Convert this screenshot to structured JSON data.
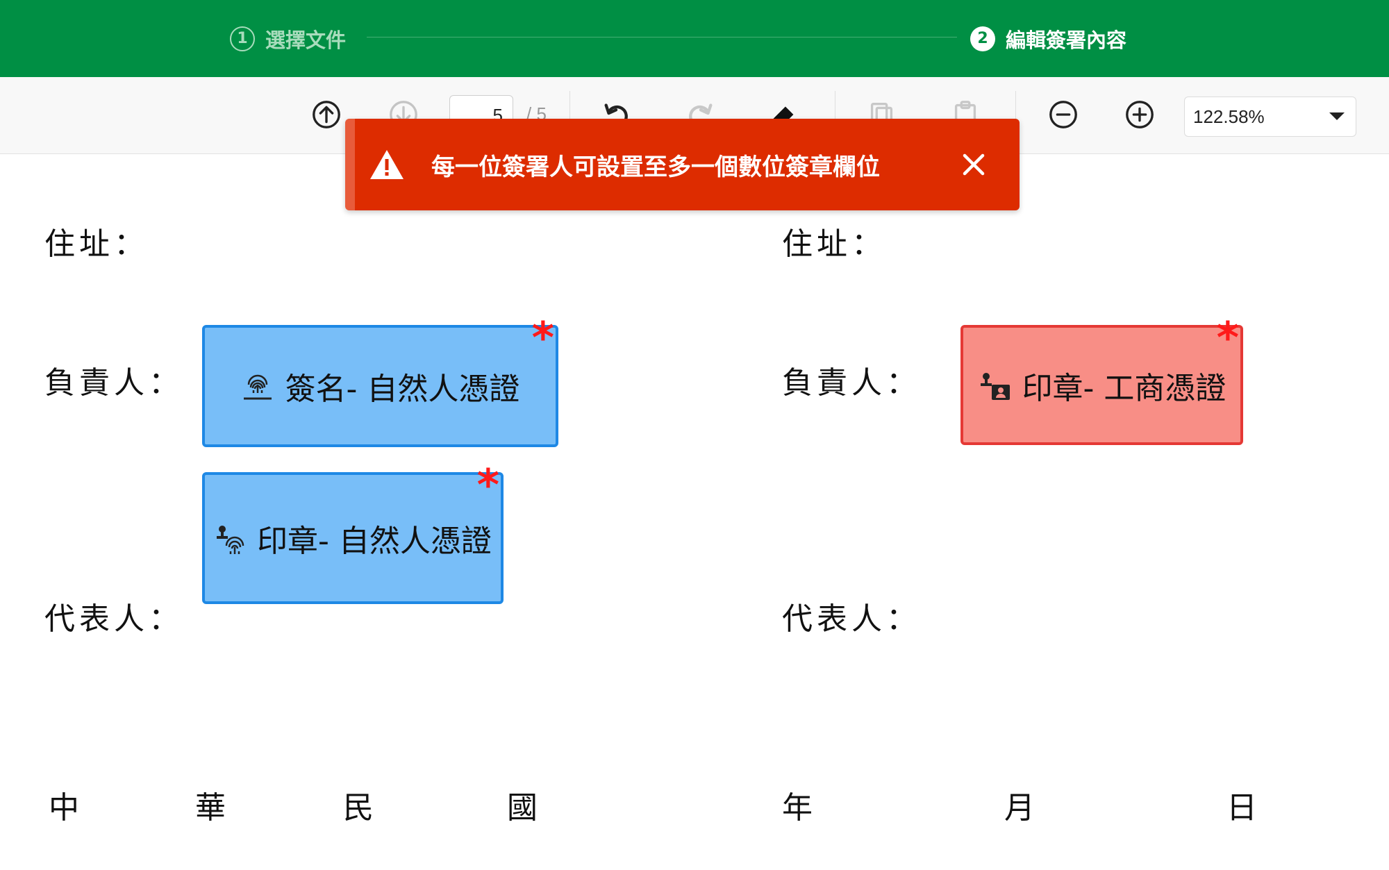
{
  "stepper": {
    "step1": {
      "number": "1",
      "label": "選擇文件"
    },
    "step2": {
      "number": "2",
      "label": "編輯簽署內容"
    }
  },
  "toolbar": {
    "page_current": "5",
    "page_total": "/ 5",
    "zoom_value": "122.58%",
    "icons": [
      "arrow-up-circle-icon",
      "arrow-down-circle-icon",
      "undo-icon",
      "redo-icon",
      "eraser-icon",
      "copy-icon",
      "paste-icon",
      "zoom-out-icon",
      "zoom-in-icon",
      "chevron-down-icon"
    ]
  },
  "toast": {
    "message": "每一位簽署人可設置至多一個數位簽章欄位",
    "icon": "warning-icon",
    "close_icon": "close-icon",
    "color": "#DD2C00"
  },
  "document": {
    "left": {
      "address_label": "住址：",
      "responsible_label": "負責人：",
      "representative_label": "代表人："
    },
    "right": {
      "address_label": "住址：",
      "responsible_label": "負責人：",
      "representative_label": "代表人："
    },
    "date_line": {
      "c1": "中",
      "c2": "華",
      "c3": "民",
      "c4": "國",
      "c5": "年",
      "c6": "月",
      "c7": "日"
    }
  },
  "fields": {
    "sign_natural": {
      "label": "簽名- 自然人憑證",
      "icon": "fingerprint-sign-icon",
      "required_mark": "*",
      "color": "#78BEF8"
    },
    "stamp_natural": {
      "label": "印章- 自然人憑證",
      "icon": "stamp-fingerprint-icon",
      "required_mark": "*",
      "color": "#78BEF8"
    },
    "stamp_business": {
      "label": "印章- 工商憑證",
      "icon": "stamp-id-card-icon",
      "required_mark": "*",
      "color": "#F88E86"
    }
  }
}
